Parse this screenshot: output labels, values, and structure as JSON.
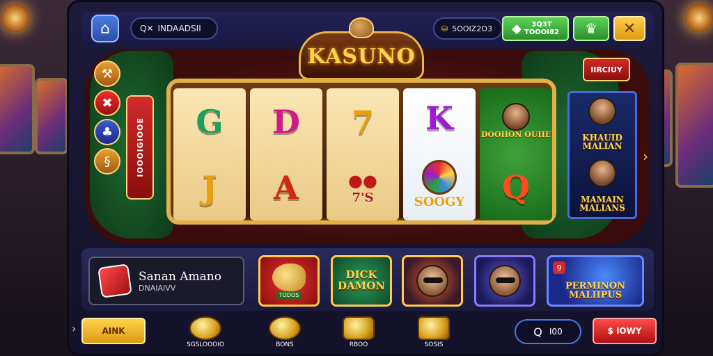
{
  "topbar": {
    "search_text": "INDAADSII",
    "coins_text": "5OOIZ2O3",
    "btn1_top": "3Q3T",
    "btn1_bottom": "TOOOI82",
    "close_symbol": "✕"
  },
  "logo": {
    "text": "KASUNO"
  },
  "side_buttons": [
    {
      "icon": "wrench-icon",
      "glyph": "⚒"
    },
    {
      "icon": "x-icon",
      "glyph": "✖"
    },
    {
      "icon": "club-icon",
      "glyph": "♣"
    },
    {
      "icon": "swirl-icon",
      "glyph": "§"
    }
  ],
  "bet_tag": {
    "label": "IOOOIGIOOE"
  },
  "top_right_btn": {
    "label": "IIRCIUY"
  },
  "reels": [
    {
      "top": "G",
      "bottom": "J",
      "top_color": "#1aa05a",
      "bottom_color": "#e8a010"
    },
    {
      "top": "D",
      "bottom": "A",
      "top_color": "#d01a8a",
      "bottom_color": "#d02a10"
    },
    {
      "top": "7",
      "bottom": "7'S",
      "top_color": "#e8a010",
      "bottom_color": "#b01818"
    },
    {
      "top": "K",
      "bottom": "SOOGY",
      "top_color": "#a01ad0",
      "bottom_color": "#e8a010"
    },
    {
      "top": "DOOIION OUIIE",
      "bottom": "Q",
      "top_color": "#ffd34a",
      "bottom_color": "#ff4a1a"
    }
  ],
  "side_panel": {
    "top_label": "KHAUID MALIAN",
    "bottom_label": "MAMAIN MALIANS"
  },
  "promo": {
    "title": "Sanan Amano",
    "subtitle": "DNAIAIVV"
  },
  "game_tiles": [
    {
      "name": "tile-horse",
      "text": "",
      "sub": "TODOS",
      "bg": "#c01818"
    },
    {
      "name": "tile-dick-damon",
      "text": "DICK DAMON",
      "sub": "",
      "bg": "#1a6a3a"
    },
    {
      "name": "tile-redhead",
      "text": "",
      "sub": "",
      "bg": "#2a1a4a"
    },
    {
      "name": "tile-shades",
      "text": "",
      "sub": "",
      "bg": "#3a2a8a"
    }
  ],
  "wide_tile": {
    "badge": "9",
    "text": "PERMINON MALIIPUS"
  },
  "bottom_bar": {
    "left_btn": "AINK",
    "coins": [
      {
        "label": "SGSLOOOIO"
      },
      {
        "label": "BONS"
      },
      {
        "label": "RBOO"
      },
      {
        "label": "SOSIS"
      }
    ],
    "bet_icon": "Q",
    "bet_value": "I00",
    "spin_btn": "$ IOWY"
  },
  "colors": {
    "gold": "#ffd34a",
    "felt_red": "#6a1c1c",
    "felt_green": "#1e6b30",
    "frame": "#1d1a3a"
  }
}
